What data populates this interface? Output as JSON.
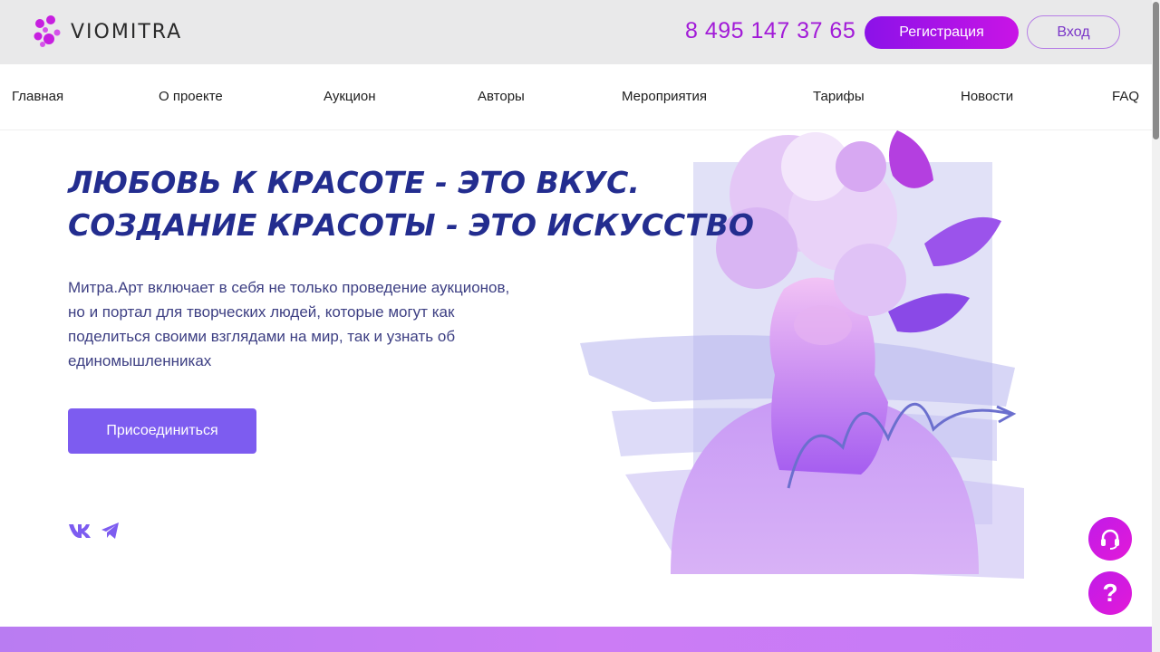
{
  "header": {
    "logo_text": "VIOMITRA",
    "phone": "8 495 147 37 65",
    "register_label": "Регистрация",
    "login_label": "Вход"
  },
  "nav": {
    "items": [
      "Главная",
      "О проекте",
      "Аукцион",
      "Авторы",
      "Мероприятия",
      "Тарифы",
      "Новости",
      "FAQ"
    ]
  },
  "hero": {
    "title_line1": "ЛЮБОВЬ К КРАСОТЕ - ЭТО ВКУС.",
    "title_line2": "СОЗДАНИЕ КРАСОТЫ - ЭТО ИСКУССТВО",
    "description": "Митра.Арт включает в себя не только проведение аукционов, но и портал для творческих людей, которые могут как поделиться своими взглядами на мир, так и узнать об единомышленниках",
    "join_label": "Присоединиться"
  },
  "socials": [
    "vk-icon",
    "telegram-icon"
  ],
  "floating": {
    "help_label": "?"
  },
  "colors": {
    "brand_purple": "#a21bd8",
    "title_blue": "#232d8f",
    "join_button": "#7d5cf0"
  }
}
